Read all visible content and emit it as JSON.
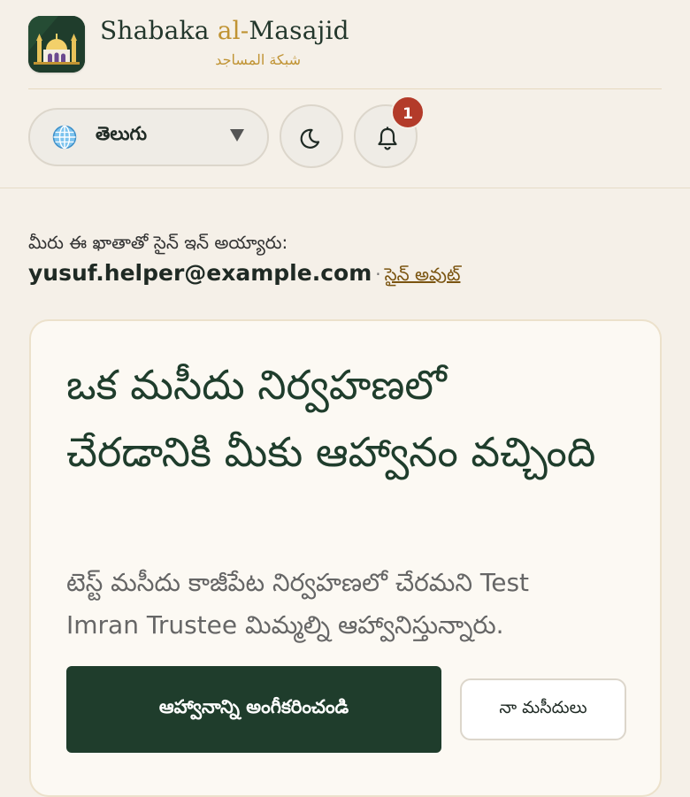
{
  "brand": {
    "name_part1": "Shabaka ",
    "name_part2": "al-",
    "name_part3": "Masajid",
    "arabic": "شبكة المساجد",
    "logo_icon": "mosque-icon"
  },
  "header": {
    "language": {
      "value": "తెలుగు",
      "icon": "globe-icon"
    },
    "theme_toggle_icon": "moon-icon",
    "notifications": {
      "icon": "bell-icon",
      "count": "1"
    }
  },
  "account": {
    "signed_in_label": "మీరు ఈ ఖాతాతో సైన్ ఇన్ అయ్యారు:",
    "email": "yusuf.helper@example.com",
    "separator": "·",
    "sign_out": "సైన్ అవుట్"
  },
  "invite": {
    "title": "ఒక మసీదు నిర్వహణలో చేరడానికి మీకు ఆహ్వానం వచ్చింది",
    "description": "టెస్ట్ మసీదు కాజీపేట నిర్వహణలో చేరమని Test Imran Trustee మిమ్మల్ని ఆహ్వానిస్తున్నారు.",
    "accept_button": "ఆహ్వానాన్ని అంగీకరించండి",
    "my_mosques_button": "నా మసీదులు"
  },
  "colors": {
    "page_background": "#f5f0e8",
    "brand_green": "#1f3d2c",
    "accent_gold": "#c09333",
    "badge_red": "#b33b2a",
    "link_brown": "#7a5410"
  }
}
